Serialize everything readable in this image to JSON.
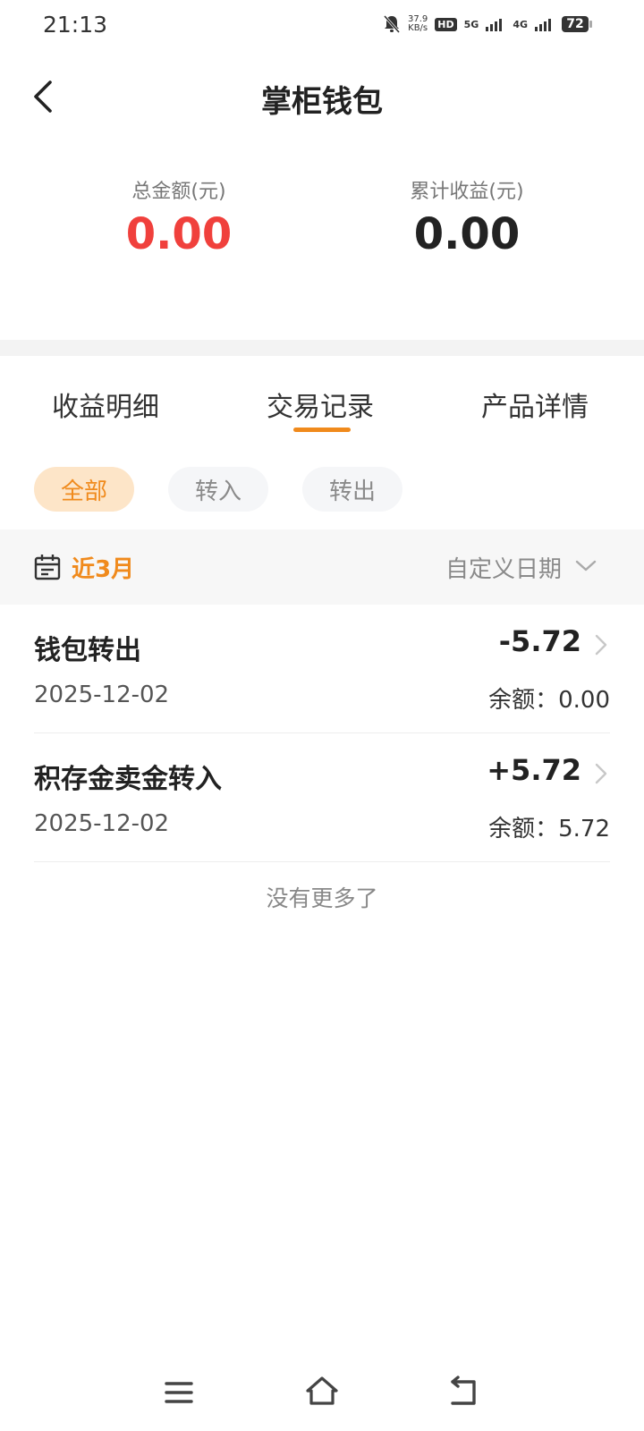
{
  "status_bar": {
    "time": "21:13",
    "speed_value": "37.9",
    "speed_unit": "KB/s",
    "hd_badge": "HD",
    "network_5g": "5G",
    "network_4g": "4G",
    "battery": "72"
  },
  "header": {
    "title": "掌柜钱包"
  },
  "summary": {
    "total_label": "总金额(元)",
    "total_value": "0.00",
    "earnings_label": "累计收益(元)",
    "earnings_value": "0.00",
    "total_value_color": "#f0403c"
  },
  "tabs": [
    {
      "label": "收益明细"
    },
    {
      "label": "交易记录"
    },
    {
      "label": "产品详情"
    }
  ],
  "active_tab_color": "#f08a1c",
  "filters": [
    {
      "label": "全部"
    },
    {
      "label": "转入"
    },
    {
      "label": "转出"
    }
  ],
  "date_bar": {
    "range": "近3月",
    "custom": "自定义日期"
  },
  "transactions": [
    {
      "title": "钱包转出",
      "date": "2025-12-02",
      "amount": "-5.72",
      "balance": "余额：0.00"
    },
    {
      "title": "积存金卖金转入",
      "date": "2025-12-02",
      "amount": "+5.72",
      "balance": "余额：5.72"
    }
  ],
  "no_more": "没有更多了"
}
